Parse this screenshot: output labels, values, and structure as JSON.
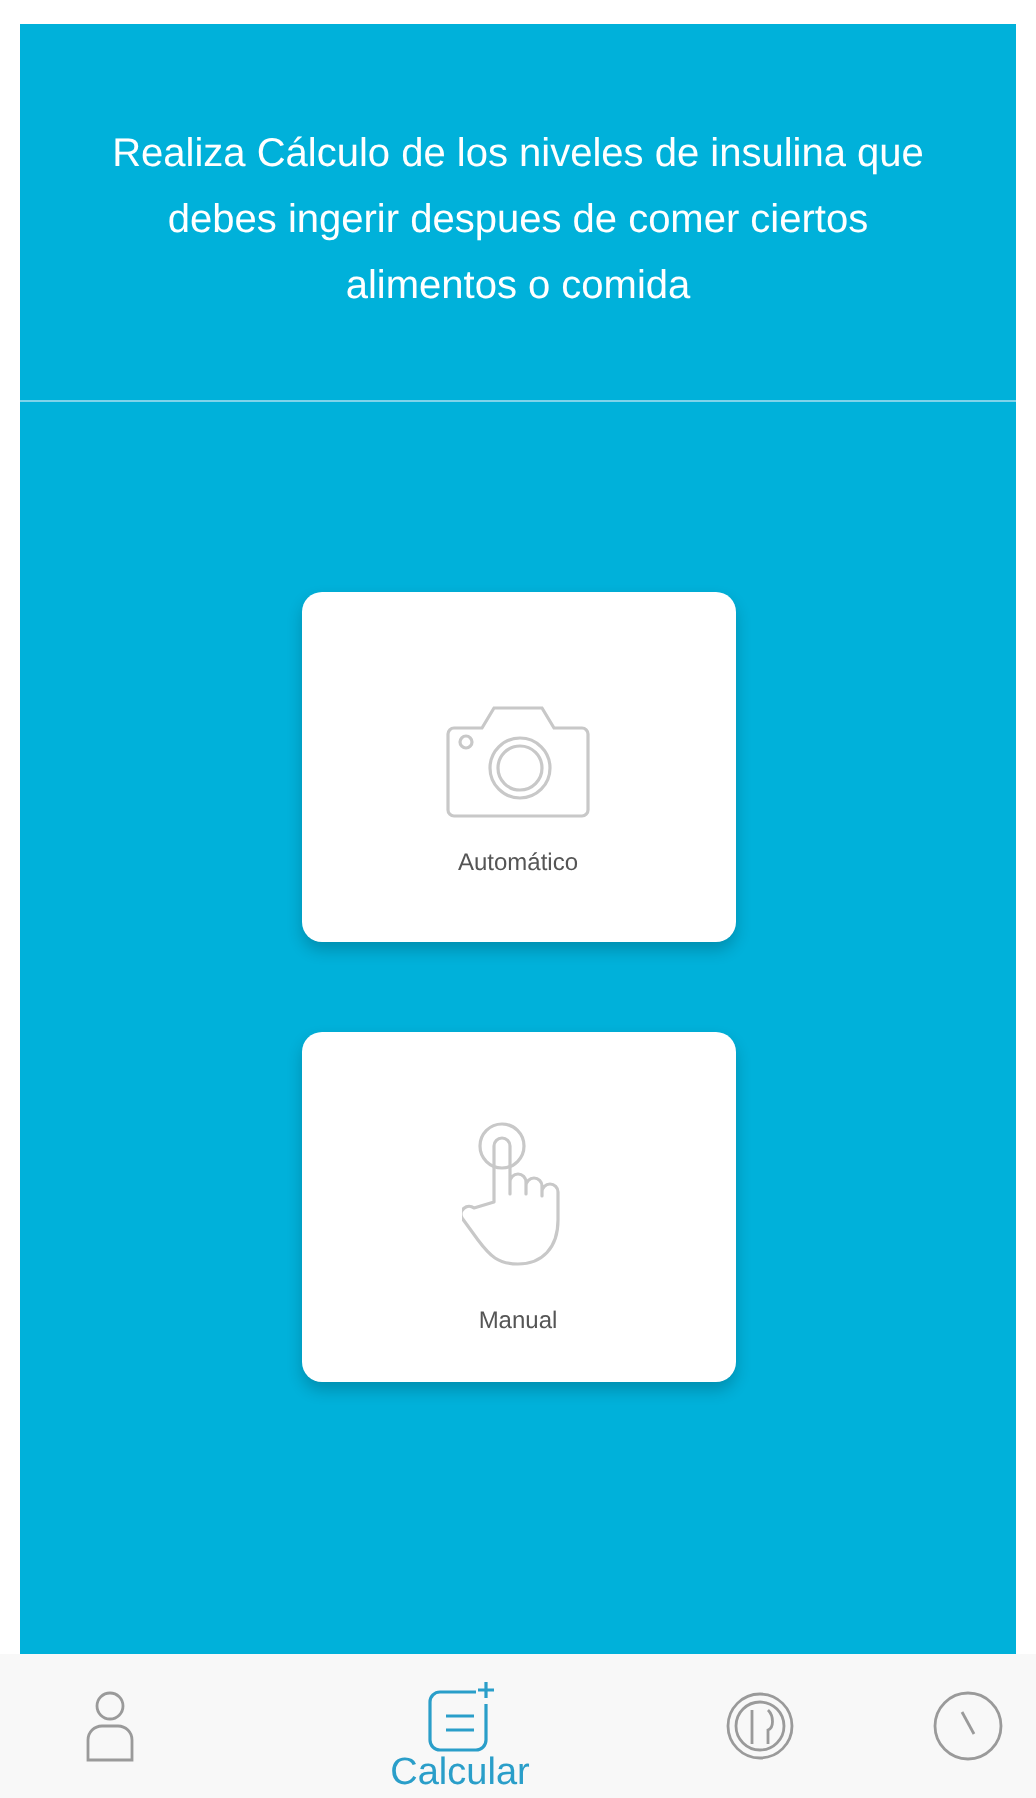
{
  "header": {
    "text": "Realiza Cálculo de los niveles de insulina que debes ingerir despues de comer ciertos alimentos o comida"
  },
  "options": [
    {
      "kind": "camera",
      "label": "Automático"
    },
    {
      "kind": "hand",
      "label": "Manual"
    }
  ],
  "nav": [
    {
      "kind": "person",
      "selected": false
    },
    {
      "kind": "calculate",
      "label": "Calcular",
      "selected": true
    },
    {
      "kind": "plate",
      "selected": false
    },
    {
      "kind": "clock",
      "selected": false
    }
  ]
}
